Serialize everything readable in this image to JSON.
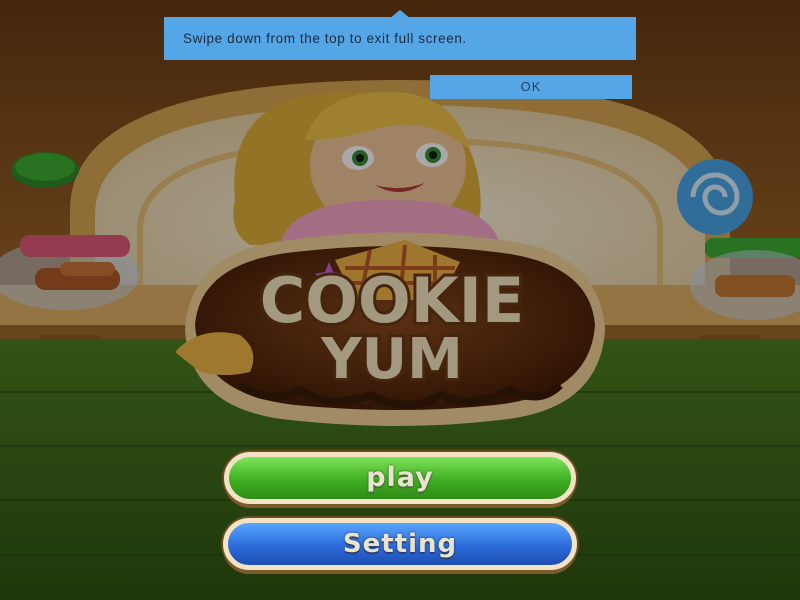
{
  "game": {
    "logo_text_line1": "COOKIE",
    "logo_text_line2": "YUM",
    "play_label": "play",
    "setting_label": "Setting"
  },
  "system_toast": {
    "message": "Swipe down from the top to exit full screen.",
    "ok_label": "OK"
  },
  "colors": {
    "toast_bg": "#55a6e6",
    "play_green": "#3fae22",
    "setting_blue": "#2a6bd9",
    "wood_brown": "#7a4a1e",
    "grass_green": "#3f6a1d"
  },
  "icons": [
    "cookie-icon",
    "swirl-candy-icon",
    "bread-icon",
    "croissant-icon",
    "star-icon"
  ]
}
